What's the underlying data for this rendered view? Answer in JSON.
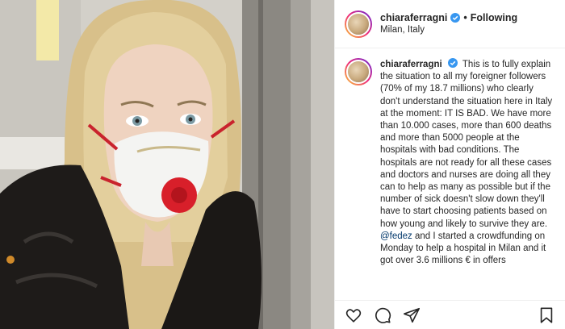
{
  "post": {
    "username": "chiaraferragni",
    "follow_status": "Following",
    "location": "Milan, Italy",
    "caption_text": "This is to fully explain the situation to all my foreigner followers (70% of my 18.7 millions) who clearly don't understand the situation here in Italy at the moment: IT IS BAD. We have more than 10.000 cases, more than 600 deaths and more than 5000 people at the hospitals with bad conditions. The hospitals are not ready for all these cases and doctors and nurses are doing all they can to help as many as possible but if the number of sick doesn't slow down they'll have to start choosing patients based on how young and likely to survive they are.",
    "mention": "@fedez",
    "caption_continued": "and I started a crowdfunding on Monday to help a hospital in Milan and it got over 3.6 millions € in offers"
  },
  "icons": {
    "verified": "verified-badge-icon",
    "like": "heart-icon",
    "comment": "comment-icon",
    "share": "share-icon",
    "save": "bookmark-icon"
  },
  "colors": {
    "verified": "#3897f0",
    "mention": "#00376b",
    "mask_valve": "#d81f2a"
  }
}
